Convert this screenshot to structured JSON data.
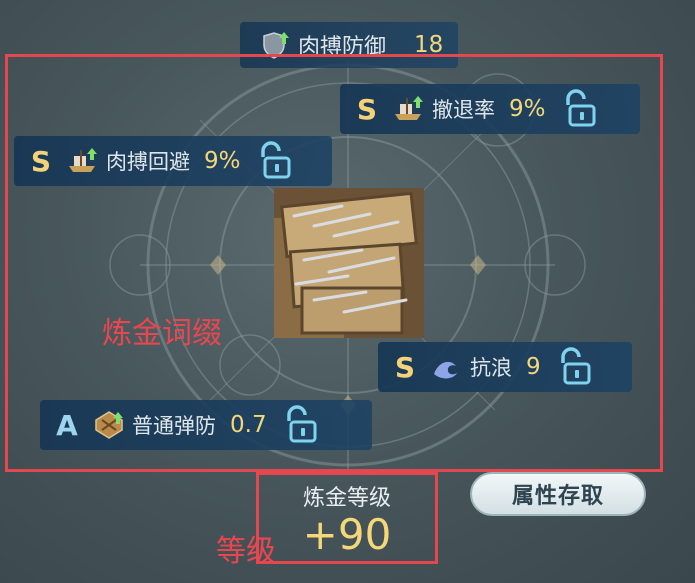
{
  "top_stat": {
    "name": "肉搏防御",
    "value": "18",
    "icon": "shield-up-icon"
  },
  "affixes": [
    {
      "id": "retreat",
      "grade": "S",
      "name": "撤退率",
      "value": "9%",
      "icon": "ship-up-icon",
      "locked": false
    },
    {
      "id": "melee-evade",
      "grade": "S",
      "name": "肉搏回避",
      "value": "9%",
      "icon": "ship-up-icon",
      "locked": false
    },
    {
      "id": "wave-resist",
      "grade": "S",
      "name": "抗浪",
      "value": "9",
      "icon": "wave-icon",
      "locked": false
    },
    {
      "id": "shot-defense",
      "grade": "A",
      "name": "普通弹防",
      "value": "0.7",
      "icon": "armor-plate-icon",
      "locked": false
    }
  ],
  "annotations": {
    "affix_label": "炼金词缀",
    "level_label": "等级"
  },
  "level": {
    "title": "炼金等级",
    "value": "+90"
  },
  "buttons": {
    "attribute_access": "属性存取"
  },
  "colors": {
    "accent_gold": "#f4d779",
    "annotation_red": "#e5474f",
    "chip_blue": "#1c4264"
  }
}
